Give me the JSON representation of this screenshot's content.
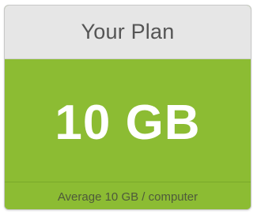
{
  "plan": {
    "title": "Your Plan",
    "size": "10 GB",
    "average": "Average 10 GB / computer"
  },
  "colors": {
    "header_bg": "#e6e6e6",
    "accent_green": "#8cbc33",
    "title_text": "#555555",
    "size_text": "#ffffff",
    "footer_text": "#4e5a3a"
  }
}
